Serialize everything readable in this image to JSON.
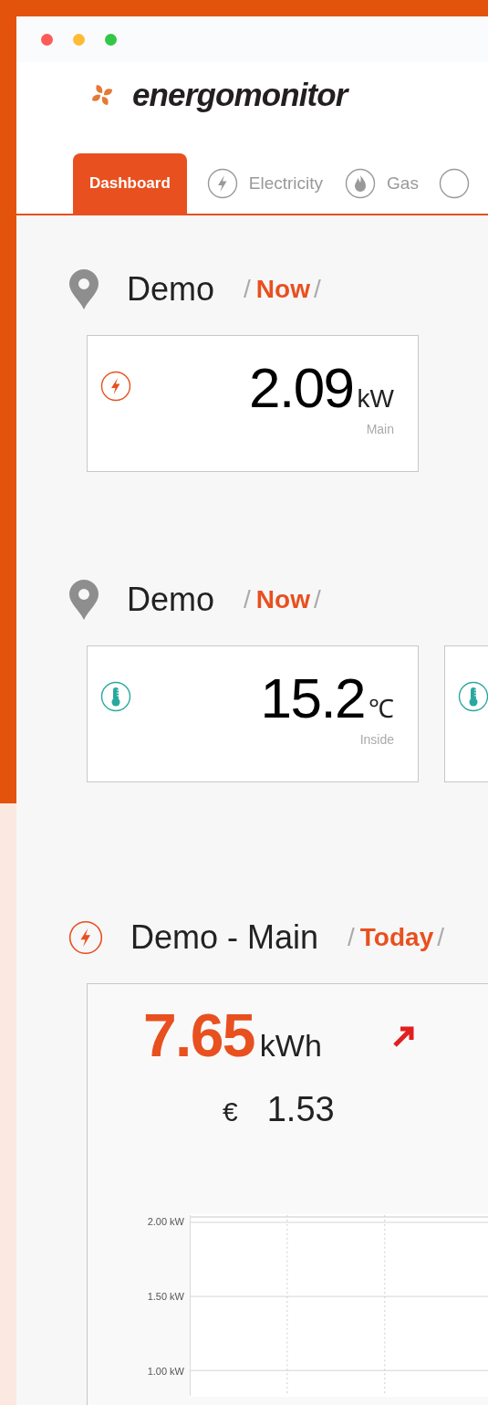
{
  "window": {
    "controls": [
      {
        "color": "#fc5b57"
      },
      {
        "color": "#ffbb36"
      },
      {
        "color": "#33c748"
      }
    ]
  },
  "brand": {
    "name": "energomonitor"
  },
  "tabs": [
    {
      "label": "Dashboard",
      "selected": true,
      "kind": "dashboard"
    },
    {
      "label": "Electricity",
      "selected": false,
      "kind": "electricity"
    },
    {
      "label": "Gas",
      "selected": false,
      "kind": "gas"
    }
  ],
  "sections": [
    {
      "kind": "location",
      "title": "Demo",
      "separator_before": "/",
      "period": "Now",
      "separator_after": "/",
      "cards": [
        {
          "kind": "electricity",
          "value": "2.09",
          "unit": "kW",
          "label": "Main"
        }
      ]
    },
    {
      "kind": "location",
      "title": "Demo",
      "separator_before": "/",
      "period": "Now",
      "separator_after": "/",
      "cards": [
        {
          "kind": "temperature",
          "value": "15.2",
          "unit": "℃",
          "label": "Inside"
        },
        {
          "kind": "temperature"
        }
      ]
    },
    {
      "kind": "meter",
      "title": "Demo - Main",
      "separator_before": "/",
      "period": "Today",
      "separator_after": "/",
      "summary": {
        "value": "7.65",
        "unit": "kWh",
        "currency": "€",
        "cost": "1.53",
        "y_axis_labels": [
          "2.00 kW",
          "1.50 kW",
          "1.00 kW"
        ]
      }
    }
  ]
}
